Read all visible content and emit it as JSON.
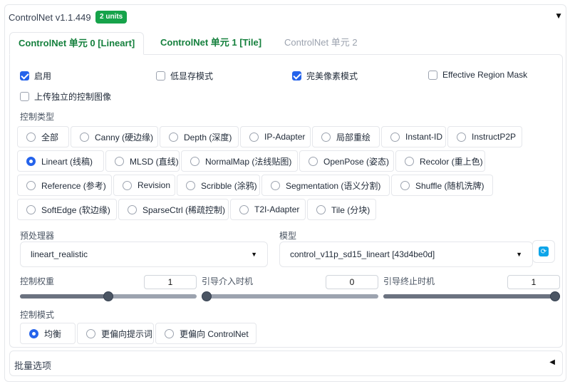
{
  "header": {
    "title": "ControlNet v1.1.449",
    "badge": "2 units",
    "collapse_icon": "triangle-down-icon"
  },
  "tabs": [
    {
      "label": "ControlNet 单元 0 [Lineart]",
      "active": true
    },
    {
      "label": "ControlNet 单元 1 [Tile]",
      "active": false
    },
    {
      "label": "ControlNet 单元 2",
      "active": false,
      "disabled": true
    }
  ],
  "options": {
    "enable": {
      "label": "启用",
      "checked": true
    },
    "low_vram": {
      "label": "低显存模式",
      "checked": false
    },
    "pixel_perfect": {
      "label": "完美像素模式",
      "checked": true
    },
    "effective_region_mask": {
      "label": "Effective Region Mask",
      "checked": false
    },
    "upload_independent": {
      "label": "上传独立的控制图像",
      "checked": false
    }
  },
  "control_type": {
    "label": "控制类型",
    "selected": "Lineart (线稿)",
    "items": [
      "全部",
      "Canny (硬边缘)",
      "Depth (深度)",
      "IP-Adapter",
      "局部重绘",
      "Instant-ID",
      "InstructP2P",
      "Lineart (线稿)",
      "MLSD (直线)",
      "NormalMap (法线贴图)",
      "OpenPose (姿态)",
      "Recolor (重上色)",
      "Reference (参考)",
      "Revision",
      "Scribble (涂鸦)",
      "Segmentation (语义分割)",
      "Shuffle (随机洗牌)",
      "SoftEdge (软边缘)",
      "SparseCtrl (稀疏控制)",
      "T2I-Adapter",
      "Tile (分块)"
    ]
  },
  "preprocessor": {
    "label": "预处理器",
    "value": "lineart_realistic"
  },
  "model": {
    "label": "模型",
    "value": "control_v11p_sd15_lineart [43d4be0d]",
    "refresh_icon": "refresh-icon"
  },
  "sliders": {
    "weight": {
      "label": "控制权重",
      "value": "1",
      "fraction": 0.5
    },
    "start": {
      "label": "引导介入时机",
      "value": "0",
      "fraction": 0.0
    },
    "end": {
      "label": "引导终止时机",
      "value": "1",
      "fraction": 1.0
    }
  },
  "control_mode": {
    "label": "控制模式",
    "selected": "均衡",
    "items": [
      "均衡",
      "更偏向提示词",
      "更偏向 ControlNet"
    ]
  },
  "batch": {
    "label": "批量选项",
    "expand_icon": "triangle-left-icon"
  },
  "colors": {
    "accent": "#2563eb",
    "badge": "#16a34a",
    "tab_text": "#15803d"
  }
}
